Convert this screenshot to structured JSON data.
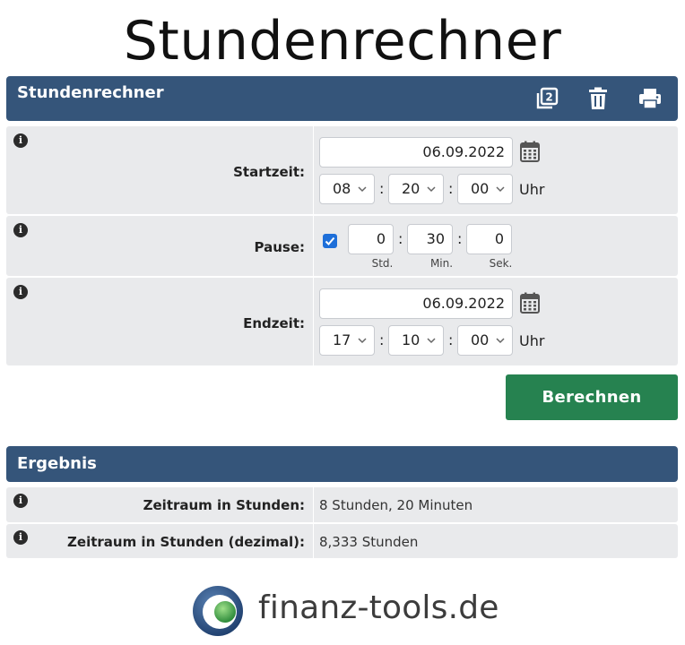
{
  "page": {
    "title": "Stundenrechner"
  },
  "calculator": {
    "header_title": "Stundenrechner",
    "icons": [
      "copy-icon",
      "trash-icon",
      "print-icon"
    ],
    "start": {
      "label": "Startzeit:",
      "date": "06.09.2022",
      "hour": "08",
      "minute": "20",
      "second": "00",
      "suffix": "Uhr"
    },
    "pause": {
      "label": "Pause:",
      "enabled": true,
      "hours": "0",
      "minutes": "30",
      "seconds": "0",
      "unit_hours": "Std.",
      "unit_minutes": "Min.",
      "unit_seconds": "Sek."
    },
    "end": {
      "label": "Endzeit:",
      "date": "06.09.2022",
      "hour": "17",
      "minute": "10",
      "second": "00",
      "suffix": "Uhr"
    },
    "calculate_label": "Berechnen"
  },
  "result": {
    "header_title": "Ergebnis",
    "rows": [
      {
        "label": "Zeitraum in Stunden:",
        "value": "8 Stunden, 20 Minuten"
      },
      {
        "label": "Zeitraum in Stunden (dezimal):",
        "value": "8,333 Stunden"
      }
    ]
  },
  "branding": {
    "logo_text": "finanz-tools.de"
  },
  "colors": {
    "header": "#35557a",
    "button": "#268250",
    "row": "#e9eaec",
    "checkbox": "#1e6fd9"
  },
  "info_glyph": "i",
  "colon": ":"
}
